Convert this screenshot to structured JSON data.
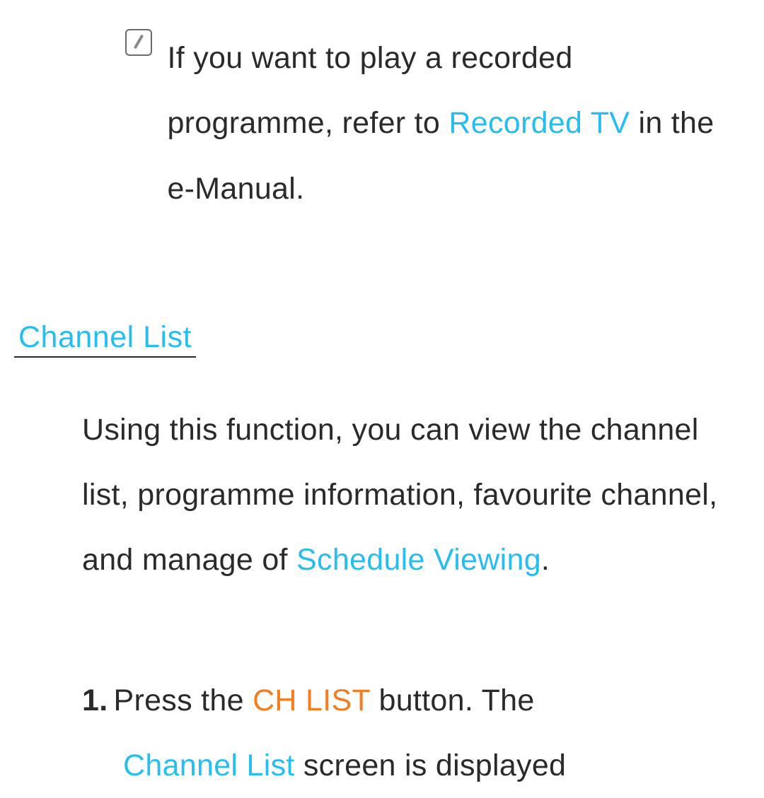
{
  "note": {
    "part1": "If you want to play a recorded programme, refer to ",
    "link": "Recorded TV",
    "part2": " in the e-Manual."
  },
  "section": {
    "heading": "Channel List",
    "intro": {
      "part1": "Using this function, you can view the channel list, programme information, favourite channel, and manage of ",
      "link": "Schedule Viewing",
      "part2": "."
    },
    "step1": {
      "number": "1.",
      "part1": "Press the ",
      "button": "CH LIST",
      "part2": " button. The ",
      "link": "Channel List",
      "part3": " screen is displayed"
    }
  }
}
